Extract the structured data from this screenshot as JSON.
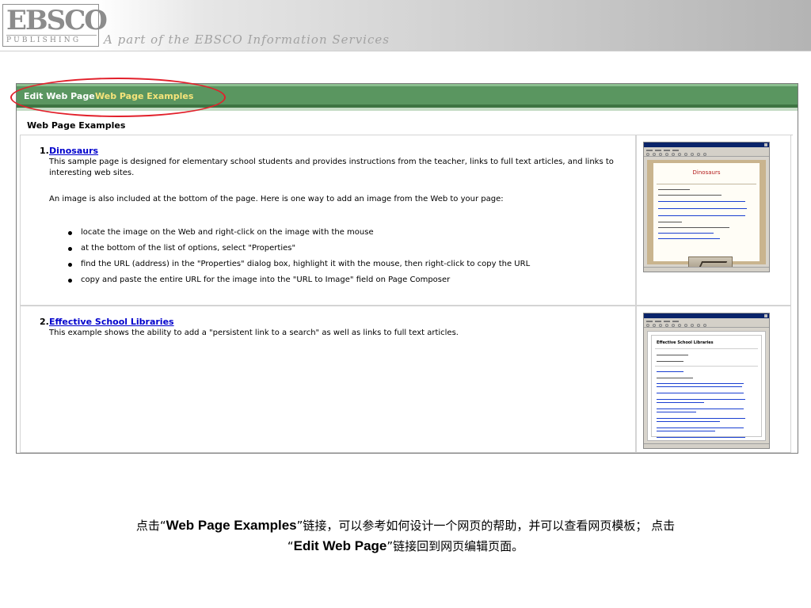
{
  "banner": {
    "logo_main": "EBSCO",
    "logo_sub": "PUBLISHING",
    "tagline": "A part of the EBSCO Information Services"
  },
  "navbar": {
    "edit_web_page": "Edit Web Page",
    "web_page_examples": "Web Page Examples",
    "bg_color": "#5a9660",
    "active_color": "#f6e47a"
  },
  "panel": {
    "title": "Web Page Examples"
  },
  "examples": [
    {
      "number": "1.",
      "link": "Dinosaurs",
      "description": "This sample page is designed for elementary school students and provides instructions from the teacher, links to full text articles, and links to interesting web sites.",
      "note": "An image is also included at the bottom of the page. Here is one way to add an image from the Web to your page:",
      "steps": [
        "locate the image on the Web and right-click on the image with the mouse",
        "at the bottom of the list of options, select \"Properties\"",
        "find the URL (address) in the \"Properties\" dialog box, highlight it with the mouse, then right-click to copy the URL",
        "copy and paste the entire URL for the image into the \"URL to Image\" field on Page Composer"
      ],
      "thumbnail_title": "Dinosaurs"
    },
    {
      "number": "2.",
      "link": "Effective School Libraries",
      "description": "This example shows the ability to add a \"persistent link to a search\" as well as links to full text articles.",
      "thumbnail_title": "Effective School Libraries"
    }
  ],
  "caption": {
    "part1": "点击“",
    "bold1": "Web Page Examples",
    "part2": "”链接，可以参考如何设计一个网页的帮助，并可以查看网页模板； 点击",
    "part3": "“",
    "bold2": "Edit Web Page",
    "part4": "”链接回到网页编辑页面。"
  },
  "annotation_color": "#e2202b"
}
